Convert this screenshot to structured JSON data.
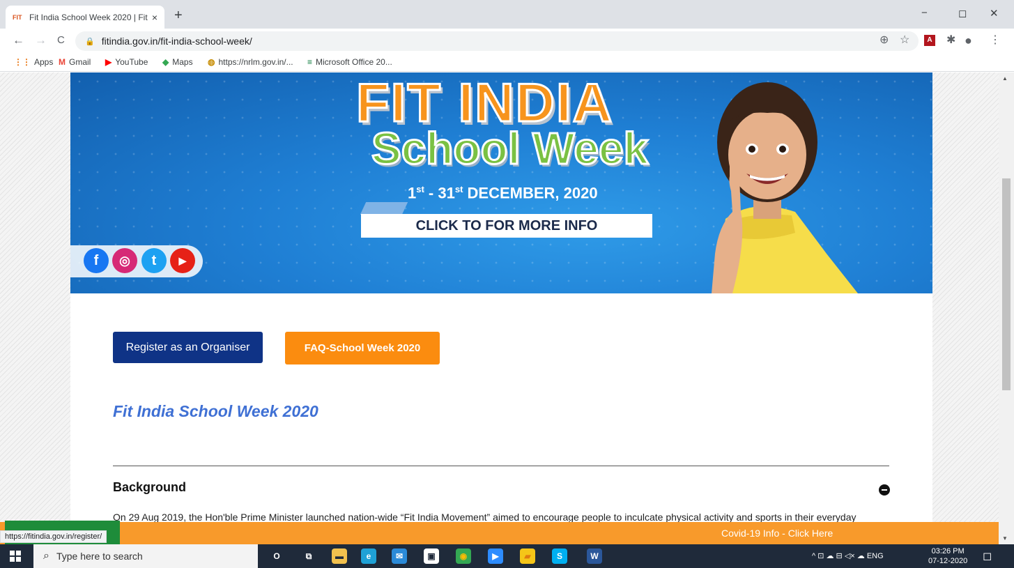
{
  "browser": {
    "tab_title": "Fit India School Week 2020 | Fit I",
    "tab_favicon_text": "FIT",
    "new_tab_symbol": "+",
    "close_symbol": "×",
    "url": "fitindia.gov.in/fit-india-school-week/",
    "window_controls": {
      "minimize": "−",
      "maximize": "◻",
      "close": "✕"
    },
    "nav": {
      "back": "←",
      "forward": "→",
      "reload": "C"
    },
    "toolbar_icons": {
      "zoom": "⊕",
      "bookmark": "☆",
      "pdf": "A",
      "extensions": "✱",
      "profile": "●",
      "menu": "⋮"
    },
    "bookmarks": [
      {
        "label": "Apps",
        "icon": "apps-grid-icon",
        "glyph": "⋮⋮",
        "color": "#e8710a"
      },
      {
        "label": "Gmail",
        "icon": "gmail-icon",
        "glyph": "M",
        "color": "#ea4335"
      },
      {
        "label": "YouTube",
        "icon": "youtube-icon",
        "glyph": "▶",
        "color": "#ff0000"
      },
      {
        "label": "Maps",
        "icon": "maps-icon",
        "glyph": "◆",
        "color": "#34a853"
      },
      {
        "label": "https://nrlm.gov.in/...",
        "icon": "nrlm-icon",
        "glyph": "◍",
        "color": "#c68b00"
      },
      {
        "label": "Microsoft Office 20...",
        "icon": "office-icon",
        "glyph": "≡",
        "color": "#107c41"
      }
    ]
  },
  "banner": {
    "title_line1": "FIT INDIA",
    "title_line2": "School Week",
    "date_start": "1",
    "date_start_suffix": "st",
    "date_separator": " - 31",
    "date_end_suffix": "st",
    "date_rest": " DECEMBER, 2020",
    "cta_label": "CLICK TO FOR MORE INFO",
    "social": [
      {
        "name": "facebook-icon",
        "glyph": "f",
        "color": "#1877f2"
      },
      {
        "name": "instagram-icon",
        "glyph": "◎",
        "color": "#d62976"
      },
      {
        "name": "twitter-icon",
        "glyph": "t",
        "color": "#1da1f2"
      },
      {
        "name": "youtube-icon",
        "glyph": "▶",
        "color": "#e62117"
      }
    ]
  },
  "buttons": {
    "register": "Register as an Organiser",
    "faq": "FAQ-School Week 2020"
  },
  "section": {
    "title": "Fit India School Week 2020",
    "background_heading": "Background",
    "background_text": "On 29 Aug 2019, the Hon'ble Prime Minister launched nation-wide “Fit India Movement” aimed to encourage people to inculcate physical activity and sports in their everyday"
  },
  "covid_bar": {
    "label": "Covid-19 Info - Click Here"
  },
  "status_url": "https://fitindia.gov.in/register/",
  "taskbar": {
    "search_placeholder": "Type here to search",
    "search_icon": "⌕",
    "tray_text": "^  ⊡  ☁  ⊟  ◁×  ☁  ENG",
    "time": "03:26 PM",
    "date": "07-12-2020",
    "notification_icon": "◻",
    "apps": [
      {
        "name": "cortana-icon",
        "glyph": "O",
        "bg": "transparent",
        "fg": "#ffffff"
      },
      {
        "name": "task-view-icon",
        "glyph": "⧉",
        "bg": "transparent",
        "fg": "#ffffff"
      },
      {
        "name": "file-explorer-icon",
        "glyph": "▬",
        "bg": "#f2c14e",
        "fg": "#1f2a3a"
      },
      {
        "name": "edge-icon",
        "glyph": "e",
        "bg": "#1fa1d6",
        "fg": "#ffffff"
      },
      {
        "name": "mail-icon",
        "glyph": "✉",
        "bg": "#2b8ad8",
        "fg": "#ffffff"
      },
      {
        "name": "store-icon",
        "glyph": "▣",
        "bg": "#ffffff",
        "fg": "#1f2a3a"
      },
      {
        "name": "chrome-icon",
        "glyph": "◉",
        "bg": "#34a853",
        "fg": "#fbbc05"
      },
      {
        "name": "zoom-icon",
        "glyph": "▶",
        "bg": "#2d8cff",
        "fg": "#ffffff"
      },
      {
        "name": "sticky-notes-icon",
        "glyph": "▰",
        "bg": "#f5c518",
        "fg": "#e07a10"
      },
      {
        "name": "skype-icon",
        "glyph": "S",
        "bg": "#00aff0",
        "fg": "#ffffff"
      },
      {
        "name": "word-icon",
        "glyph": "W",
        "bg": "#2b579a",
        "fg": "#ffffff"
      }
    ]
  }
}
